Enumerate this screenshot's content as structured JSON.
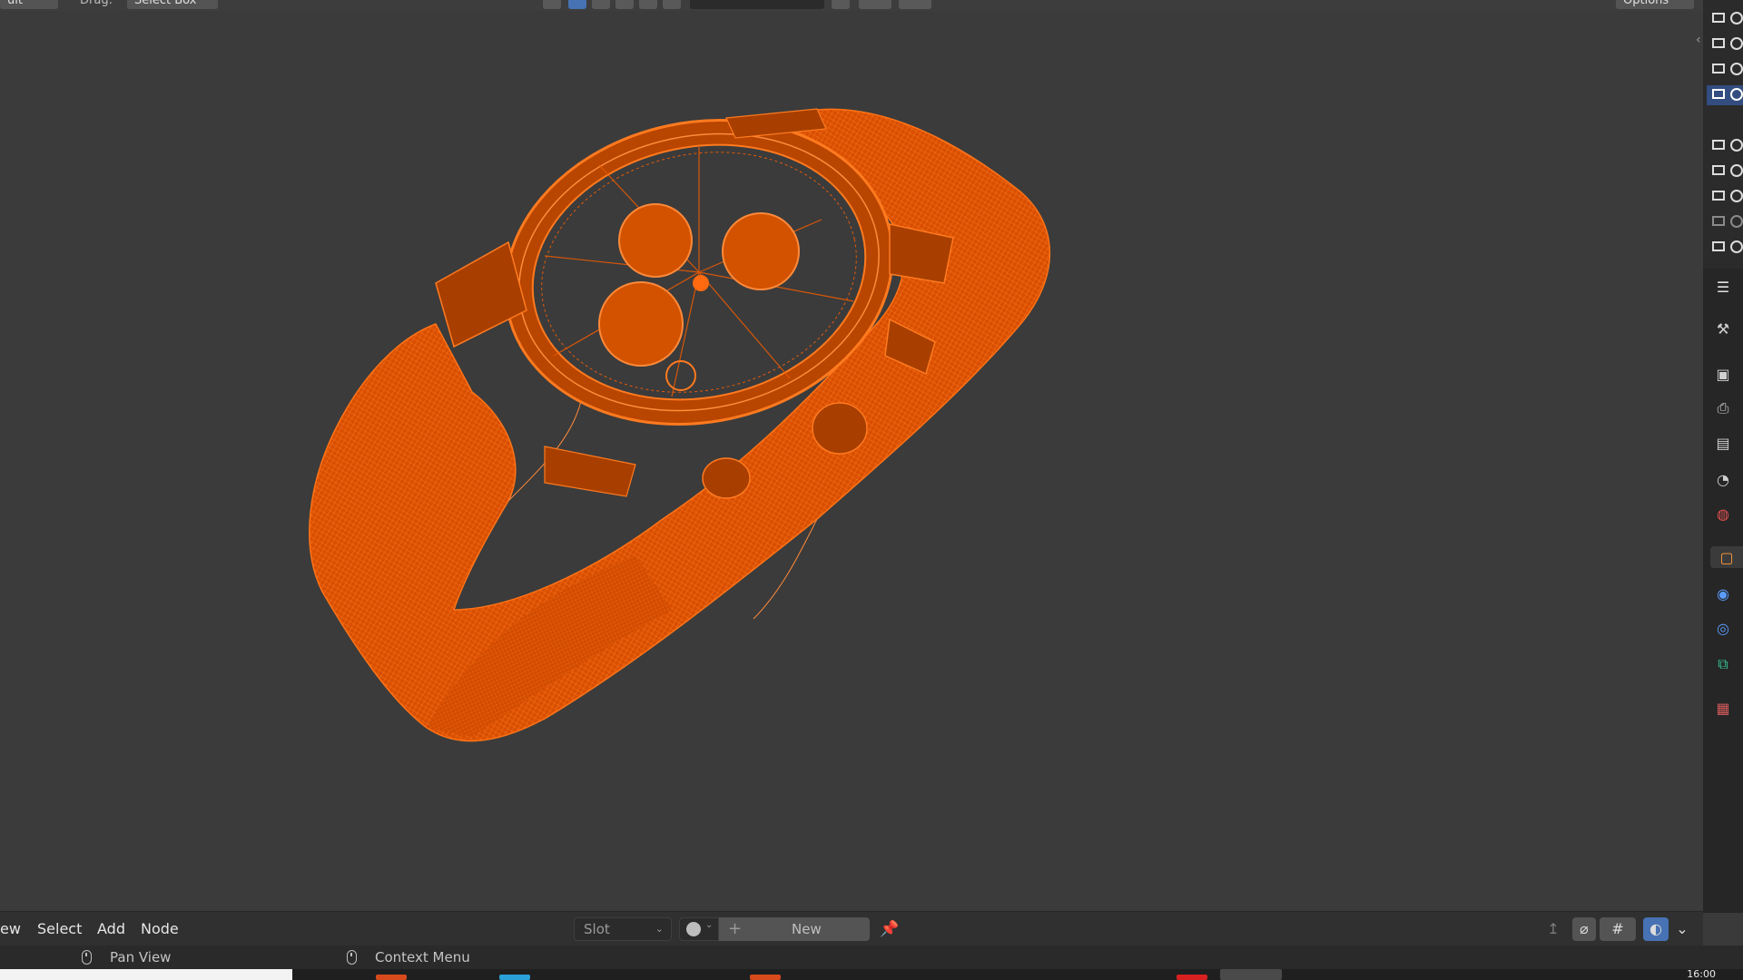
{
  "top_header": {
    "mode_label": "ult",
    "drag_label": "Drag:",
    "drag_value": "Select Box",
    "options_label": "Options"
  },
  "viewport": {
    "object": "wristwatch",
    "colors": {
      "background": "#3b3b3b",
      "wireframe": "#e85a05"
    }
  },
  "node_header": {
    "menus": [
      "ew",
      "Select",
      "Add",
      "Node"
    ],
    "slot_label": "Slot",
    "new_label": "New"
  },
  "status_bar": {
    "pan_label": "Pan View",
    "context_label": "Context Menu"
  },
  "taskbar": {
    "clock": "16:00"
  },
  "colors": {
    "accent_blue": "#4772b3",
    "orange": "#e85a05"
  }
}
